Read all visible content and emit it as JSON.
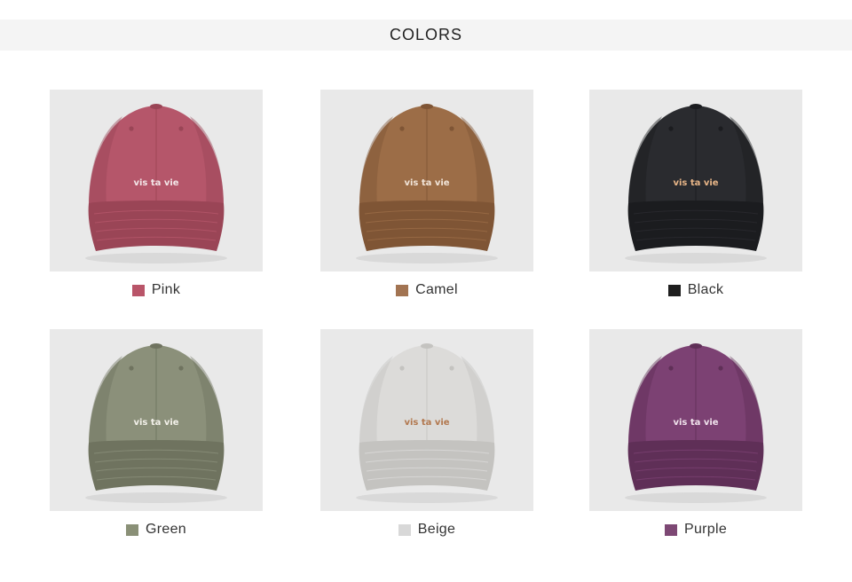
{
  "header": {
    "title": "COLORS"
  },
  "embroidery_text": "vis ta vie",
  "products": [
    {
      "label": "Pink",
      "swatch": "#b95569",
      "cap": "#b5566a",
      "shade": "#9a4556",
      "thread": "#f3e6e8"
    },
    {
      "label": "Camel",
      "swatch": "#a27452",
      "cap": "#9c6d47",
      "shade": "#7f5535",
      "thread": "#f1e4d8"
    },
    {
      "label": "Black",
      "swatch": "#1e1e1e",
      "cap": "#2a2b2f",
      "shade": "#1b1c1f",
      "thread": "#e7b587"
    },
    {
      "label": "Green",
      "swatch": "#8a9077",
      "cap": "#8b907a",
      "shade": "#6f735f",
      "thread": "#f3f1ea"
    },
    {
      "label": "Beige",
      "swatch": "#d8d8d8",
      "cap": "#dcdbd9",
      "shade": "#c4c3c0",
      "thread": "#b2784f"
    },
    {
      "label": "Purple",
      "swatch": "#7d4874",
      "cap": "#7c4173",
      "shade": "#5f2f57",
      "thread": "#f0e2ec"
    }
  ]
}
